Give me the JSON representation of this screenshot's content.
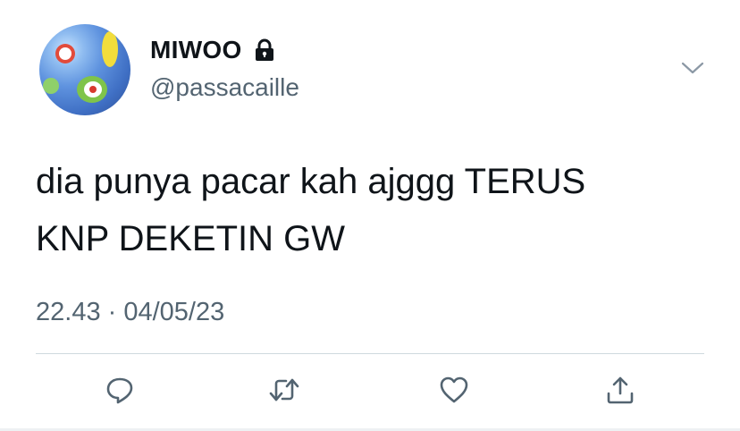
{
  "tweet": {
    "display_name": "MIWOO",
    "handle": "@passacaille",
    "text_line1": "dia punya pacar kah ajggg TERUS",
    "text_line2": "KNP DEKETIN GW",
    "timestamp": "22.43 · 04/05/23"
  },
  "icons": {
    "protected": "lock-icon",
    "more": "chevron-down-icon",
    "reply": "reply-icon",
    "retweet": "retweet-icon",
    "like": "heart-icon",
    "share": "share-icon"
  },
  "colors": {
    "text": "#0f1419",
    "secondary": "#536471",
    "divider": "#cfd9de",
    "icon": "#536471"
  }
}
